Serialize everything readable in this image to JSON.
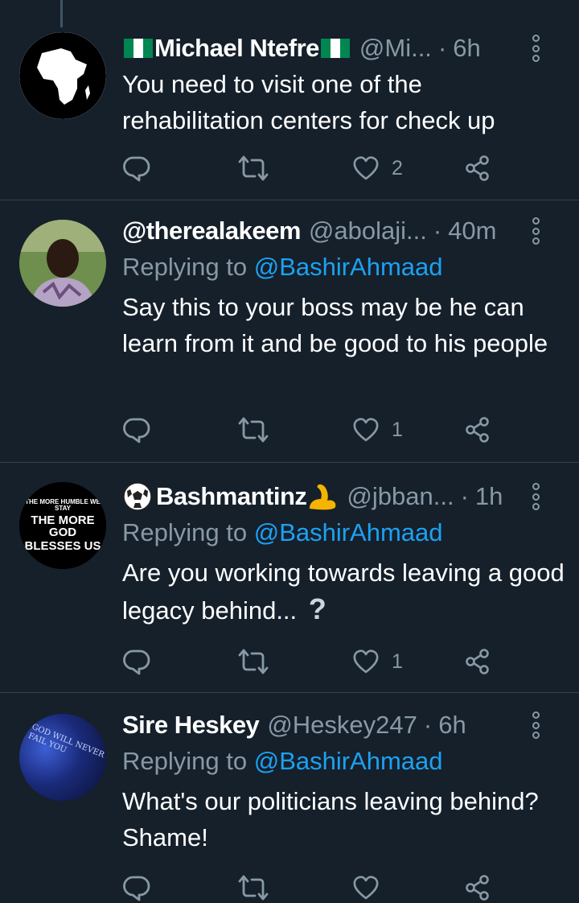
{
  "tweets": [
    {
      "name": "Michael Ntefre",
      "handle": "@Mi...",
      "time": "6h",
      "replying_label": "",
      "replying_handle": "",
      "text": "You need to visit one of the rehabilitation centers for check up",
      "likes": "2",
      "avatar": "africa-map-avatar"
    },
    {
      "name": "@therealakeem",
      "handle": "@abolaji...",
      "time": "40m",
      "replying_label": "Replying to",
      "replying_handle": "@BashirAhmaad",
      "text": "Say this to your boss may be he can learn from it and be good to his people",
      "likes": "1",
      "avatar": "person-photo-avatar"
    },
    {
      "name": "Bashmantinz",
      "handle": "@jbban...",
      "time": "1h",
      "replying_label": "Replying to",
      "replying_handle": "@BashirAhmaad",
      "text": "Are you working towards leaving a good legacy behind...",
      "likes": "1",
      "avatar": "quote-text-avatar",
      "avatar_text": [
        "THE MORE HUMBLE WE STAY",
        "THE MORE GOD",
        "BLESSES US"
      ]
    },
    {
      "name": "Sire Heskey",
      "handle": "@Heskey247",
      "time": "6h",
      "replying_label": "Replying to",
      "replying_handle": "@BashirAhmaad",
      "text": "What's our politicians leaving behind? Shame!",
      "likes": "",
      "avatar": "blue-sign-avatar",
      "avatar_text": [
        "GOD",
        "WILL",
        "NEVER",
        "FAIL YOU"
      ]
    }
  ],
  "separator": "·",
  "question_mark": "?",
  "colors": {
    "background": "#15202b",
    "secondary_text": "#8899a6",
    "link": "#1da1f2",
    "divider": "#38444d"
  }
}
